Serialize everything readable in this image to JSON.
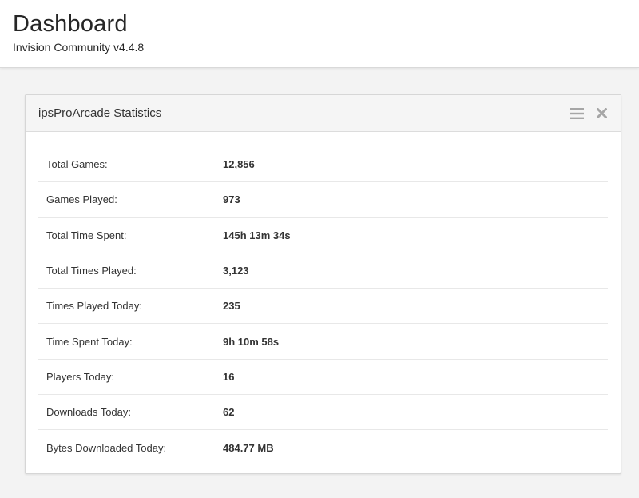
{
  "header": {
    "title": "Dashboard",
    "subtitle": "Invision Community v4.4.8"
  },
  "widget": {
    "title": "ipsProArcade Statistics",
    "tools": {
      "reorder_icon": "hamburger-menu-icon",
      "close_icon": "close-icon"
    },
    "stats": [
      {
        "label": "Total Games:",
        "value": "12,856"
      },
      {
        "label": "Games Played:",
        "value": "973"
      },
      {
        "label": "Total Time Spent:",
        "value": "145h 13m 34s"
      },
      {
        "label": "Total Times Played:",
        "value": "3,123"
      },
      {
        "label": "Times Played Today:",
        "value": "235"
      },
      {
        "label": "Time Spent Today:",
        "value": "9h 10m 58s"
      },
      {
        "label": "Players Today:",
        "value": "16"
      },
      {
        "label": "Downloads Today:",
        "value": "62"
      },
      {
        "label": "Bytes Downloaded Today:",
        "value": "484.77 MB"
      }
    ]
  },
  "colors": {
    "page_background": "#f3f3f3",
    "header_background": "#ffffff",
    "widget_header_background": "#f5f5f5",
    "icon_color": "#a6a6a6",
    "text_color": "#333333"
  }
}
